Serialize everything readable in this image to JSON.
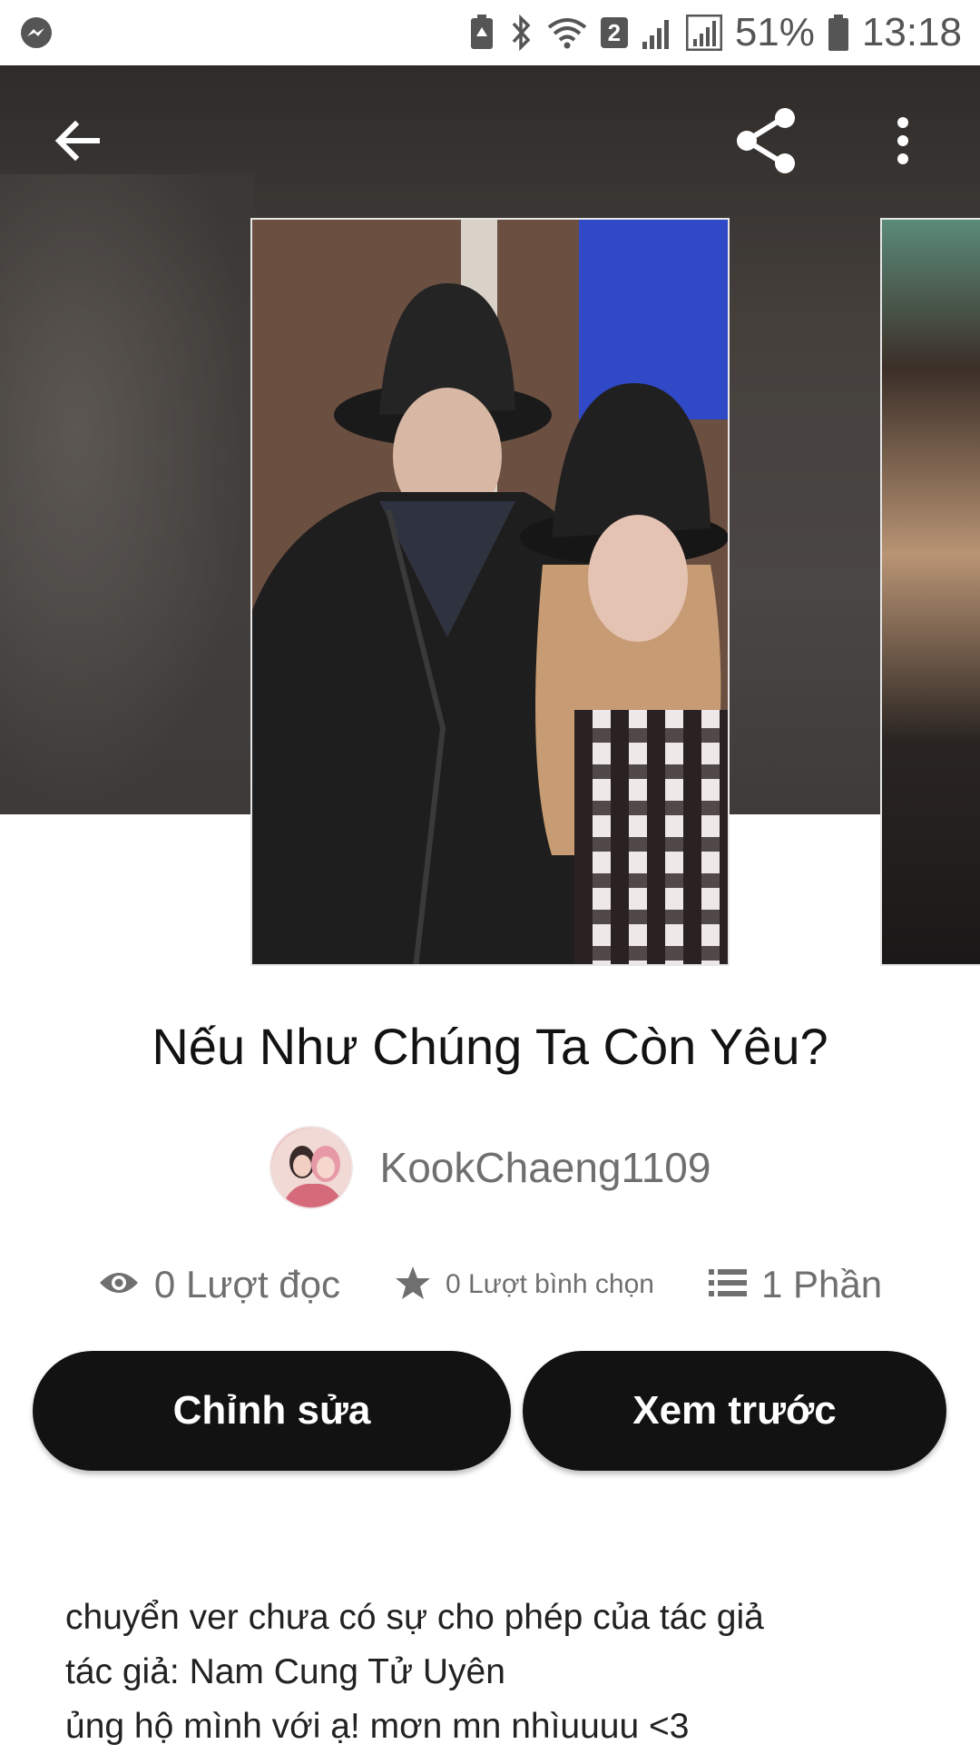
{
  "status_bar": {
    "battery_percent": "51%",
    "time": "13:18",
    "sim_badge": "2",
    "icons": [
      "messenger-icon",
      "battery-saver-icon",
      "bluetooth-icon",
      "wifi-icon",
      "signal-icon",
      "signal-icon",
      "battery-icon"
    ]
  },
  "nav": {
    "icons": [
      "back-arrow-icon",
      "share-icon",
      "more-vert-icon"
    ]
  },
  "story": {
    "title": "Nếu Như Chúng Ta Còn Yêu?",
    "author": "KookChaeng1109",
    "stats": {
      "reads": "0 Lượt đọc",
      "votes": "0 Lượt bình chọn",
      "parts": "1 Phần"
    },
    "buttons": {
      "edit": "Chỉnh sửa",
      "preview": "Xem trước"
    },
    "description": [
      "chuyển ver chưa có sự cho phép của tác giả",
      "tác giả: Nam Cung Tử Uyên",
      "ủng hộ mình với ạ! mơn mn nhìuuuu <3"
    ]
  },
  "colors": {
    "button_bg": "#121212",
    "button_text": "#ffffff",
    "title_text": "#121212",
    "muted_text": "#6f6f6f"
  }
}
